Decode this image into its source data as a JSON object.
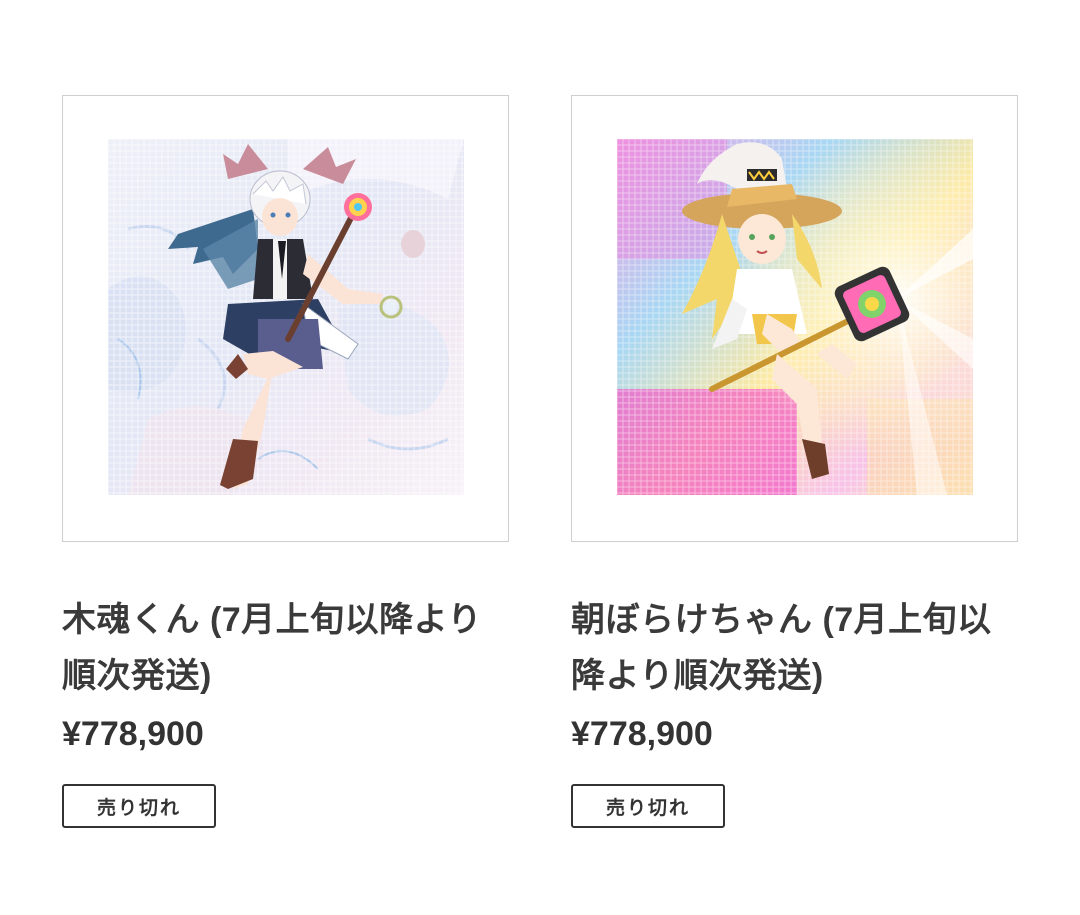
{
  "products": [
    {
      "title": "木魂くん (7月上旬以降より順次発送)",
      "price": "¥778,900",
      "badge": "売り切れ",
      "artwork": {
        "subject": "white-haired boy with bat wings holding rainbow flower staff",
        "palette": [
          "#e8e4f2",
          "#cfd9ee",
          "#f4eef8",
          "#3b5e86",
          "#6b3f2f"
        ]
      }
    },
    {
      "title": "朝ぼらけちゃん (7月上旬以降より順次発送)",
      "price": "¥778,900",
      "badge": "売り切れ",
      "artwork": {
        "subject": "blonde witch girl with wide hat riding rainbow flower staff",
        "palette": [
          "#f36fd0",
          "#8fd8f5",
          "#ffe27a",
          "#f0b26b",
          "#e7a640"
        ]
      }
    }
  ]
}
